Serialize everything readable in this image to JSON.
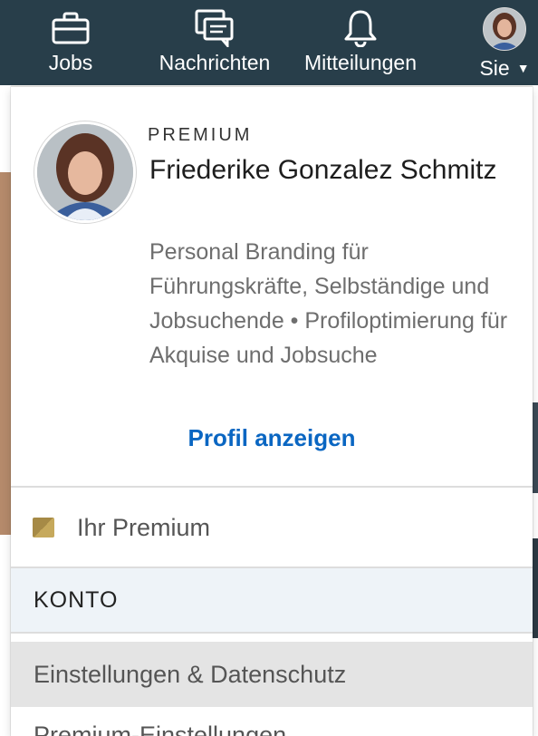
{
  "nav": {
    "jobs_label": "Jobs",
    "messages_label": "Nachrichten",
    "notifications_label": "Mitteilungen",
    "me_label": "Sie"
  },
  "dropdown": {
    "premium_badge": "PREMIUM",
    "name": "Friederike Gonzalez Schmitz",
    "headline": "Personal Branding für Führungskräfte, Selbständige und Jobsuchende • Profiloptimierung für Akquise und Jobsuche",
    "view_profile_label": "Profil anzeigen",
    "premium_item_label": "Ihr Premium",
    "account_section_label": "KONTO",
    "settings_item_label": "Einstellungen & Datenschutz",
    "premium_settings_item_label": "Premium-Einstellungen"
  },
  "icons": {
    "jobs": "briefcase-icon",
    "messages": "chat-icon",
    "notifications": "bell-icon",
    "caret": "caret-down-icon",
    "premium": "premium-gold-icon"
  },
  "colors": {
    "topbar_bg": "#283e4a",
    "link": "#0a66c2",
    "premium_gold": "#a68a46",
    "section_header_bg": "#eef3f8",
    "hover_row_bg": "#e4e4e4"
  }
}
